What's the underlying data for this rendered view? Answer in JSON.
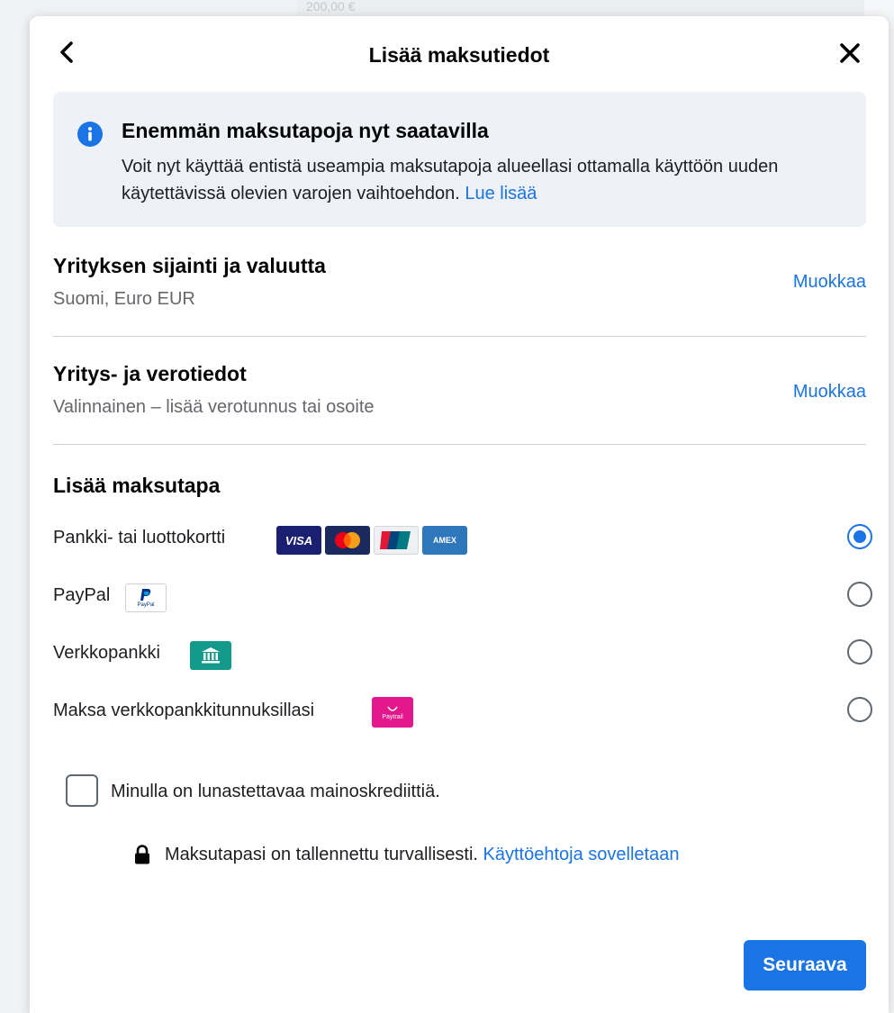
{
  "backdrop": {
    "top_amount": "200,00 €"
  },
  "dialog": {
    "title": "Lisää maksutiedot",
    "back_icon": "chevron-left-icon",
    "close_icon": "close-icon"
  },
  "banner": {
    "icon": "info-icon",
    "title": "Enemmän maksutapoja nyt saatavilla",
    "body": "Voit nyt käyttää entistä useampia maksutapoja alueellasi ottamalla käyttöön uuden käytettävissä olevien varojen vaihtoehdon.",
    "link": "Lue lisää"
  },
  "business_location": {
    "title": "Yrityksen sijainti ja valuutta",
    "value": "Suomi, Euro EUR",
    "edit_label": "Muokkaa"
  },
  "tax_info": {
    "title": "Yritys- ja verotiedot",
    "value": "Valinnainen – lisää verotunnus tai osoite",
    "edit_label": "Muokkaa"
  },
  "payment_methods": {
    "heading": "Lisää maksutapa",
    "items": [
      {
        "label": "Pankki- tai luottokortti",
        "selected": true,
        "icons": [
          "visa-card-icon",
          "mastercard-icon",
          "unionpay-icon",
          "amex-icon"
        ]
      },
      {
        "label": "PayPal",
        "selected": false,
        "icons": [
          "paypal-icon"
        ]
      },
      {
        "label": "Verkkopankki",
        "selected": false,
        "icons": [
          "bank-icon"
        ]
      },
      {
        "label": "Maksa verkkopankkitunnuksillasi",
        "selected": false,
        "icons": [
          "paytrail-icon"
        ]
      }
    ],
    "card_text": {
      "visa": "VISA",
      "amex": "AMEX",
      "unionpay": "UnionPay",
      "paypal": "PayPal",
      "paytrail": "Paytrail"
    }
  },
  "ad_credit": {
    "label": "Minulla on lunastettavaa mainoskrediittiä.",
    "checked": false
  },
  "secure_note": {
    "text": "Maksutapasi on tallennettu turvallisesti.",
    "link": "Käyttöehtoja sovelletaan"
  },
  "footer": {
    "next_label": "Seuraava"
  },
  "colors": {
    "accent": "#1b74e4",
    "banner_bg": "#eef1f6",
    "bank_green": "#149a8a",
    "paytrail_pink": "#e4188c"
  }
}
